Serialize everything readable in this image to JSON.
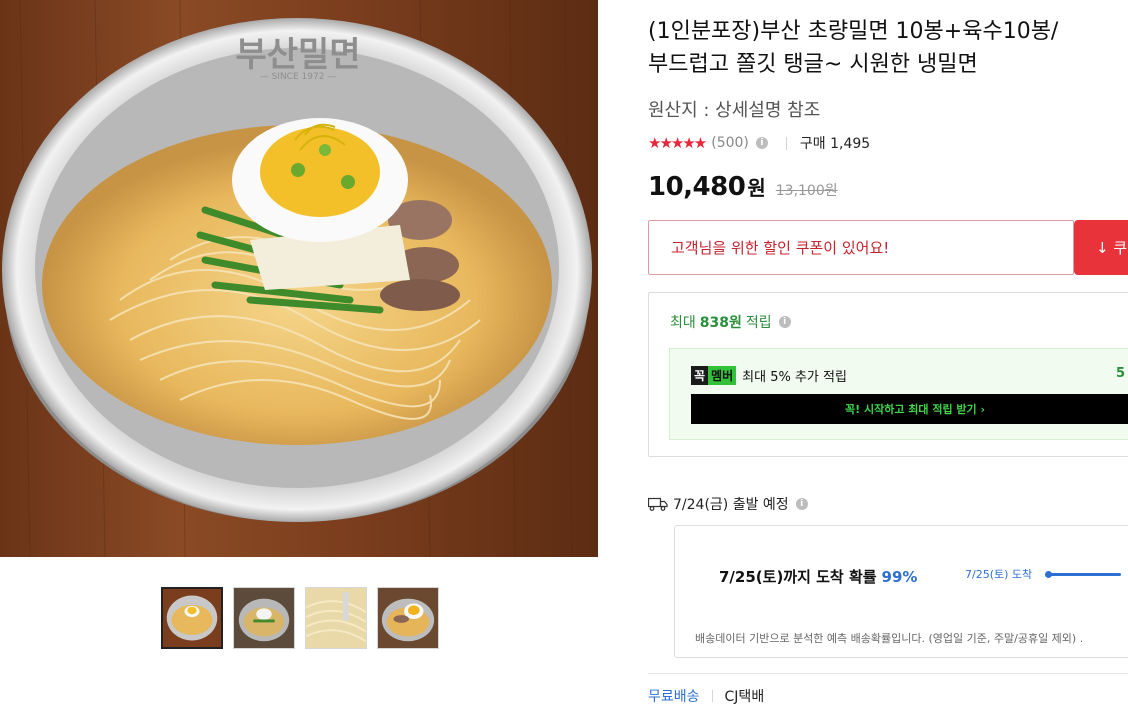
{
  "product": {
    "title_line1": "(1인분포장)부산 초량밀면 10봉+육수10봉/",
    "title_line2": "부드럽고 쫄깃 탱글~ 시원한 냉밀면",
    "origin": "원산지 : 상세설명 참조",
    "rating": 4.5,
    "stars_display": "★★★★★",
    "review_count": "(500)",
    "purchase_count": "구매 1,495",
    "price": "10,480",
    "price_unit": "원",
    "original_price": "13,100원"
  },
  "gallery": {
    "bowl_brand": "부산밀면",
    "bowl_since": "— SINCE 1972 —",
    "thumbnails": [
      "thumb-1",
      "thumb-2",
      "thumb-3",
      "thumb-4"
    ],
    "active_index": 0
  },
  "coupon": {
    "message": "고객님을 위한 할인 쿠폰이 있어요!",
    "button_label": "↓ 쿠"
  },
  "points": {
    "prefix": "최대",
    "amount": "838원",
    "suffix": "적립",
    "member_logo_dark": "꼭",
    "member_logo_green": "멤버",
    "member_text": "최대 5% 추가 적립",
    "member_right": "5",
    "member_button": "꼭! 시작하고 최대 적립 받기 ›"
  },
  "shipping": {
    "departure": "7/24(금) 출발 예정",
    "arrival_text": "7/25(토)까지 도착 확률",
    "arrival_pct": "99%",
    "arrival_chip": "7/25(토) 도착",
    "arrival_probability": 0.99,
    "note": "배송데이터 기반으로 분석한 예측 배송확률입니다. (영업일 기준, 주말/공휴일 제외) .",
    "free": "무료배송",
    "courier": "CJ택배"
  },
  "colors": {
    "accent_red": "#e8333b",
    "star_red": "#e8253a",
    "point_green": "#2a8f3a",
    "link_blue": "#2e6fd3"
  },
  "icons": [
    "info-icon",
    "truck-icon",
    "download-icon"
  ]
}
